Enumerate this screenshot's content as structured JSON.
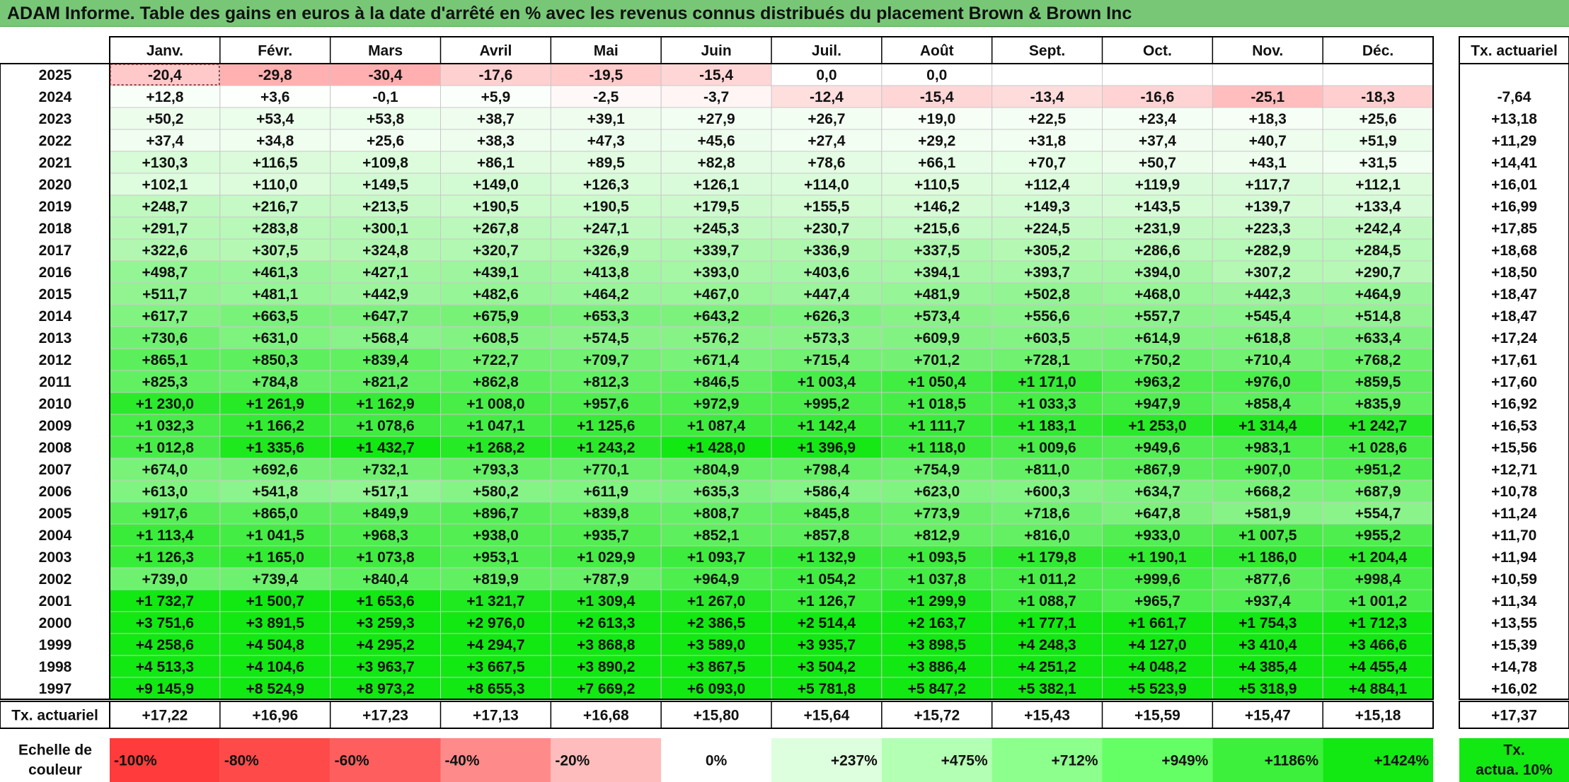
{
  "title": "ADAM Informe. Table des gains en euros à la date d'arrêté en % avec les revenus connus distribués du placement Brown & Brown Inc",
  "chart_data": {
    "type": "heatmap",
    "columns": [
      "Janv.",
      "Févr.",
      "Mars",
      "Avril",
      "Mai",
      "Juin",
      "Juil.",
      "Août",
      "Sept.",
      "Oct.",
      "Nov.",
      "Déc."
    ],
    "annual_header": "Tx. actuariel",
    "footer_label": "Tx. actuariel",
    "rows": [
      {
        "year": "2025",
        "cells": [
          -20.4,
          -29.8,
          -30.4,
          -17.6,
          -19.5,
          -15.4,
          0.0,
          0.0,
          null,
          null,
          null,
          null
        ],
        "labels": [
          "-20,4",
          "-29,8",
          "-30,4",
          "-17,6",
          "-19,5",
          "-15,4",
          "0,0",
          "0,0",
          "",
          "",
          "",
          ""
        ],
        "tx": ""
      },
      {
        "year": "2024",
        "cells": [
          12.8,
          3.6,
          -0.1,
          5.9,
          -2.5,
          -3.7,
          -12.4,
          -15.4,
          -13.4,
          -16.6,
          -25.1,
          -18.3
        ],
        "labels": [
          "+12,8",
          "+3,6",
          "-0,1",
          "+5,9",
          "-2,5",
          "-3,7",
          "-12,4",
          "-15,4",
          "-13,4",
          "-16,6",
          "-25,1",
          "-18,3"
        ],
        "tx": "-7,64"
      },
      {
        "year": "2023",
        "cells": [
          50.2,
          53.4,
          53.8,
          38.7,
          39.1,
          27.9,
          26.7,
          19.0,
          22.5,
          23.4,
          18.3,
          25.6
        ],
        "labels": [
          "+50,2",
          "+53,4",
          "+53,8",
          "+38,7",
          "+39,1",
          "+27,9",
          "+26,7",
          "+19,0",
          "+22,5",
          "+23,4",
          "+18,3",
          "+25,6"
        ],
        "tx": "+13,18"
      },
      {
        "year": "2022",
        "cells": [
          37.4,
          34.8,
          25.6,
          38.3,
          47.3,
          45.6,
          27.4,
          29.2,
          31.8,
          37.4,
          40.7,
          51.9
        ],
        "labels": [
          "+37,4",
          "+34,8",
          "+25,6",
          "+38,3",
          "+47,3",
          "+45,6",
          "+27,4",
          "+29,2",
          "+31,8",
          "+37,4",
          "+40,7",
          "+51,9"
        ],
        "tx": "+11,29"
      },
      {
        "year": "2021",
        "cells": [
          130.3,
          116.5,
          109.8,
          86.1,
          89.5,
          82.8,
          78.6,
          66.1,
          70.7,
          50.7,
          43.1,
          31.5
        ],
        "labels": [
          "+130,3",
          "+116,5",
          "+109,8",
          "+86,1",
          "+89,5",
          "+82,8",
          "+78,6",
          "+66,1",
          "+70,7",
          "+50,7",
          "+43,1",
          "+31,5"
        ],
        "tx": "+14,41"
      },
      {
        "year": "2020",
        "cells": [
          102.1,
          110.0,
          149.5,
          149.0,
          126.3,
          126.1,
          114.0,
          110.5,
          112.4,
          119.9,
          117.7,
          112.1
        ],
        "labels": [
          "+102,1",
          "+110,0",
          "+149,5",
          "+149,0",
          "+126,3",
          "+126,1",
          "+114,0",
          "+110,5",
          "+112,4",
          "+119,9",
          "+117,7",
          "+112,1"
        ],
        "tx": "+16,01"
      },
      {
        "year": "2019",
        "cells": [
          248.7,
          216.7,
          213.5,
          190.5,
          190.5,
          179.5,
          155.5,
          146.2,
          149.3,
          143.5,
          139.7,
          133.4
        ],
        "labels": [
          "+248,7",
          "+216,7",
          "+213,5",
          "+190,5",
          "+190,5",
          "+179,5",
          "+155,5",
          "+146,2",
          "+149,3",
          "+143,5",
          "+139,7",
          "+133,4"
        ],
        "tx": "+16,99"
      },
      {
        "year": "2018",
        "cells": [
          291.7,
          283.8,
          300.1,
          267.8,
          247.1,
          245.3,
          230.7,
          215.6,
          224.5,
          231.9,
          223.3,
          242.4
        ],
        "labels": [
          "+291,7",
          "+283,8",
          "+300,1",
          "+267,8",
          "+247,1",
          "+245,3",
          "+230,7",
          "+215,6",
          "+224,5",
          "+231,9",
          "+223,3",
          "+242,4"
        ],
        "tx": "+17,85"
      },
      {
        "year": "2017",
        "cells": [
          322.6,
          307.5,
          324.8,
          320.7,
          326.9,
          339.7,
          336.9,
          337.5,
          305.2,
          286.6,
          282.9,
          284.5
        ],
        "labels": [
          "+322,6",
          "+307,5",
          "+324,8",
          "+320,7",
          "+326,9",
          "+339,7",
          "+336,9",
          "+337,5",
          "+305,2",
          "+286,6",
          "+282,9",
          "+284,5"
        ],
        "tx": "+18,68"
      },
      {
        "year": "2016",
        "cells": [
          498.7,
          461.3,
          427.1,
          439.1,
          413.8,
          393.0,
          403.6,
          394.1,
          393.7,
          394.0,
          307.2,
          290.7
        ],
        "labels": [
          "+498,7",
          "+461,3",
          "+427,1",
          "+439,1",
          "+413,8",
          "+393,0",
          "+403,6",
          "+394,1",
          "+393,7",
          "+394,0",
          "+307,2",
          "+290,7"
        ],
        "tx": "+18,50"
      },
      {
        "year": "2015",
        "cells": [
          511.7,
          481.1,
          442.9,
          482.6,
          464.2,
          467.0,
          447.4,
          481.9,
          502.8,
          468.0,
          442.3,
          464.9
        ],
        "labels": [
          "+511,7",
          "+481,1",
          "+442,9",
          "+482,6",
          "+464,2",
          "+467,0",
          "+447,4",
          "+481,9",
          "+502,8",
          "+468,0",
          "+442,3",
          "+464,9"
        ],
        "tx": "+18,47"
      },
      {
        "year": "2014",
        "cells": [
          617.7,
          663.5,
          647.7,
          675.9,
          653.3,
          643.2,
          626.3,
          573.4,
          556.6,
          557.7,
          545.4,
          514.8
        ],
        "labels": [
          "+617,7",
          "+663,5",
          "+647,7",
          "+675,9",
          "+653,3",
          "+643,2",
          "+626,3",
          "+573,4",
          "+556,6",
          "+557,7",
          "+545,4",
          "+514,8"
        ],
        "tx": "+18,47"
      },
      {
        "year": "2013",
        "cells": [
          730.6,
          631.0,
          568.4,
          608.5,
          574.5,
          576.2,
          573.3,
          609.9,
          603.5,
          614.9,
          618.8,
          633.4
        ],
        "labels": [
          "+730,6",
          "+631,0",
          "+568,4",
          "+608,5",
          "+574,5",
          "+576,2",
          "+573,3",
          "+609,9",
          "+603,5",
          "+614,9",
          "+618,8",
          "+633,4"
        ],
        "tx": "+17,24"
      },
      {
        "year": "2012",
        "cells": [
          865.1,
          850.3,
          839.4,
          722.7,
          709.7,
          671.4,
          715.4,
          701.2,
          728.1,
          750.2,
          710.4,
          768.2
        ],
        "labels": [
          "+865,1",
          "+850,3",
          "+839,4",
          "+722,7",
          "+709,7",
          "+671,4",
          "+715,4",
          "+701,2",
          "+728,1",
          "+750,2",
          "+710,4",
          "+768,2"
        ],
        "tx": "+17,61"
      },
      {
        "year": "2011",
        "cells": [
          825.3,
          784.8,
          821.2,
          862.8,
          812.3,
          846.5,
          1003.4,
          1050.4,
          1171.0,
          963.2,
          976.0,
          859.5
        ],
        "labels": [
          "+825,3",
          "+784,8",
          "+821,2",
          "+862,8",
          "+812,3",
          "+846,5",
          "+1 003,4",
          "+1 050,4",
          "+1 171,0",
          "+963,2",
          "+976,0",
          "+859,5"
        ],
        "tx": "+17,60"
      },
      {
        "year": "2010",
        "cells": [
          1230.0,
          1261.9,
          1162.9,
          1008.0,
          957.6,
          972.9,
          995.2,
          1018.5,
          1033.3,
          947.9,
          858.4,
          835.9
        ],
        "labels": [
          "+1 230,0",
          "+1 261,9",
          "+1 162,9",
          "+1 008,0",
          "+957,6",
          "+972,9",
          "+995,2",
          "+1 018,5",
          "+1 033,3",
          "+947,9",
          "+858,4",
          "+835,9"
        ],
        "tx": "+16,92"
      },
      {
        "year": "2009",
        "cells": [
          1032.3,
          1166.2,
          1078.6,
          1047.1,
          1125.6,
          1087.4,
          1142.4,
          1111.7,
          1183.1,
          1253.0,
          1314.4,
          1242.7
        ],
        "labels": [
          "+1 032,3",
          "+1 166,2",
          "+1 078,6",
          "+1 047,1",
          "+1 125,6",
          "+1 087,4",
          "+1 142,4",
          "+1 111,7",
          "+1 183,1",
          "+1 253,0",
          "+1 314,4",
          "+1 242,7"
        ],
        "tx": "+16,53"
      },
      {
        "year": "2008",
        "cells": [
          1012.8,
          1335.6,
          1432.7,
          1268.2,
          1243.2,
          1428.0,
          1396.9,
          1118.0,
          1009.6,
          949.6,
          983.1,
          1028.6
        ],
        "labels": [
          "+1 012,8",
          "+1 335,6",
          "+1 432,7",
          "+1 268,2",
          "+1 243,2",
          "+1 428,0",
          "+1 396,9",
          "+1 118,0",
          "+1 009,6",
          "+949,6",
          "+983,1",
          "+1 028,6"
        ],
        "tx": "+15,56"
      },
      {
        "year": "2007",
        "cells": [
          674.0,
          692.6,
          732.1,
          793.3,
          770.1,
          804.9,
          798.4,
          754.9,
          811.0,
          867.9,
          907.0,
          951.2
        ],
        "labels": [
          "+674,0",
          "+692,6",
          "+732,1",
          "+793,3",
          "+770,1",
          "+804,9",
          "+798,4",
          "+754,9",
          "+811,0",
          "+867,9",
          "+907,0",
          "+951,2"
        ],
        "tx": "+12,71"
      },
      {
        "year": "2006",
        "cells": [
          613.0,
          541.8,
          517.1,
          580.2,
          611.9,
          635.3,
          586.4,
          623.0,
          600.3,
          634.7,
          668.2,
          687.9
        ],
        "labels": [
          "+613,0",
          "+541,8",
          "+517,1",
          "+580,2",
          "+611,9",
          "+635,3",
          "+586,4",
          "+623,0",
          "+600,3",
          "+634,7",
          "+668,2",
          "+687,9"
        ],
        "tx": "+10,78"
      },
      {
        "year": "2005",
        "cells": [
          917.6,
          865.0,
          849.9,
          896.7,
          839.8,
          808.7,
          845.8,
          773.9,
          718.6,
          647.8,
          581.9,
          554.7
        ],
        "labels": [
          "+917,6",
          "+865,0",
          "+849,9",
          "+896,7",
          "+839,8",
          "+808,7",
          "+845,8",
          "+773,9",
          "+718,6",
          "+647,8",
          "+581,9",
          "+554,7"
        ],
        "tx": "+11,24"
      },
      {
        "year": "2004",
        "cells": [
          1113.4,
          1041.5,
          968.3,
          938.0,
          935.7,
          852.1,
          857.8,
          812.9,
          816.0,
          933.0,
          1007.5,
          955.2
        ],
        "labels": [
          "+1 113,4",
          "+1 041,5",
          "+968,3",
          "+938,0",
          "+935,7",
          "+852,1",
          "+857,8",
          "+812,9",
          "+816,0",
          "+933,0",
          "+1 007,5",
          "+955,2"
        ],
        "tx": "+11,70"
      },
      {
        "year": "2003",
        "cells": [
          1126.3,
          1165.0,
          1073.8,
          953.1,
          1029.9,
          1093.7,
          1132.9,
          1093.5,
          1179.8,
          1190.1,
          1186.0,
          1204.4
        ],
        "labels": [
          "+1 126,3",
          "+1 165,0",
          "+1 073,8",
          "+953,1",
          "+1 029,9",
          "+1 093,7",
          "+1 132,9",
          "+1 093,5",
          "+1 179,8",
          "+1 190,1",
          "+1 186,0",
          "+1 204,4"
        ],
        "tx": "+11,94"
      },
      {
        "year": "2002",
        "cells": [
          739.0,
          739.4,
          840.4,
          819.9,
          787.9,
          964.9,
          1054.2,
          1037.8,
          1011.2,
          999.6,
          877.6,
          998.4
        ],
        "labels": [
          "+739,0",
          "+739,4",
          "+840,4",
          "+819,9",
          "+787,9",
          "+964,9",
          "+1 054,2",
          "+1 037,8",
          "+1 011,2",
          "+999,6",
          "+877,6",
          "+998,4"
        ],
        "tx": "+10,59"
      },
      {
        "year": "2001",
        "cells": [
          1732.7,
          1500.7,
          1653.6,
          1321.7,
          1309.4,
          1267.0,
          1126.7,
          1299.9,
          1088.7,
          965.7,
          937.4,
          1001.2
        ],
        "labels": [
          "+1 732,7",
          "+1 500,7",
          "+1 653,6",
          "+1 321,7",
          "+1 309,4",
          "+1 267,0",
          "+1 126,7",
          "+1 299,9",
          "+1 088,7",
          "+965,7",
          "+937,4",
          "+1 001,2"
        ],
        "tx": "+11,34"
      },
      {
        "year": "2000",
        "cells": [
          3751.6,
          3891.5,
          3259.3,
          2976.0,
          2613.3,
          2386.5,
          2514.4,
          2163.7,
          1777.1,
          1661.7,
          1754.3,
          1712.3
        ],
        "labels": [
          "+3 751,6",
          "+3 891,5",
          "+3 259,3",
          "+2 976,0",
          "+2 613,3",
          "+2 386,5",
          "+2 514,4",
          "+2 163,7",
          "+1 777,1",
          "+1 661,7",
          "+1 754,3",
          "+1 712,3"
        ],
        "tx": "+13,55"
      },
      {
        "year": "1999",
        "cells": [
          4258.6,
          4504.8,
          4295.2,
          4294.7,
          3868.8,
          3589.0,
          3935.7,
          3898.5,
          4248.3,
          4127.0,
          3410.4,
          3466.6
        ],
        "labels": [
          "+4 258,6",
          "+4 504,8",
          "+4 295,2",
          "+4 294,7",
          "+3 868,8",
          "+3 589,0",
          "+3 935,7",
          "+3 898,5",
          "+4 248,3",
          "+4 127,0",
          "+3 410,4",
          "+3 466,6"
        ],
        "tx": "+15,39"
      },
      {
        "year": "1998",
        "cells": [
          4513.3,
          4104.6,
          3963.7,
          3667.5,
          3890.2,
          3867.5,
          3504.2,
          3886.4,
          4251.2,
          4048.2,
          4385.4,
          4455.4
        ],
        "labels": [
          "+4 513,3",
          "+4 104,6",
          "+3 963,7",
          "+3 667,5",
          "+3 890,2",
          "+3 867,5",
          "+3 504,2",
          "+3 886,4",
          "+4 251,2",
          "+4 048,2",
          "+4 385,4",
          "+4 455,4"
        ],
        "tx": "+14,78"
      },
      {
        "year": "1997",
        "cells": [
          9145.9,
          8524.9,
          8973.2,
          8655.3,
          7669.2,
          6093.0,
          5781.8,
          5847.2,
          5382.1,
          5523.9,
          5318.9,
          4884.1
        ],
        "labels": [
          "+9 145,9",
          "+8 524,9",
          "+8 973,2",
          "+8 655,3",
          "+7 669,2",
          "+6 093,0",
          "+5 781,8",
          "+5 847,2",
          "+5 382,1",
          "+5 523,9",
          "+5 318,9",
          "+4 884,1"
        ],
        "tx": "+16,02"
      }
    ],
    "footer_values": [
      "+17,22",
      "+16,96",
      "+17,23",
      "+17,13",
      "+16,68",
      "+15,80",
      "+15,64",
      "+15,72",
      "+15,43",
      "+15,59",
      "+15,47",
      "+15,18"
    ],
    "footer_total": "+17,37",
    "legend": {
      "label_line1": "Echelle de",
      "label_line2": "couleur",
      "items": [
        {
          "text": "-100%",
          "color": "#ff3b3b",
          "align": "left"
        },
        {
          "text": "-80%",
          "color": "#ff4a4a",
          "align": "left"
        },
        {
          "text": "-60%",
          "color": "#ff5e5e",
          "align": "left"
        },
        {
          "text": "-40%",
          "color": "#ff8a8a",
          "align": "left"
        },
        {
          "text": "-20%",
          "color": "#ffbcbc",
          "align": "left"
        },
        {
          "text": "0%",
          "color": "#ffffff",
          "align": "center"
        },
        {
          "text": "+237%",
          "color": "#ddffdd",
          "align": "right"
        },
        {
          "text": "+475%",
          "color": "#b3ffb3",
          "align": "right"
        },
        {
          "text": "+712%",
          "color": "#8cff8c",
          "align": "right"
        },
        {
          "text": "+949%",
          "color": "#64ff64",
          "align": "right"
        },
        {
          "text": "+1186%",
          "color": "#3cf03c",
          "align": "right"
        },
        {
          "text": "+1424%",
          "color": "#12e812",
          "align": "right"
        }
      ],
      "tx_line1": "Tx.",
      "tx_line2": "actua. 10%",
      "tx_color": "#12e812"
    },
    "color_scale": {
      "neg_min": -100,
      "pos_max": 1424,
      "neg_color": "#ff3b3b",
      "pos_color": "#12e812"
    }
  }
}
